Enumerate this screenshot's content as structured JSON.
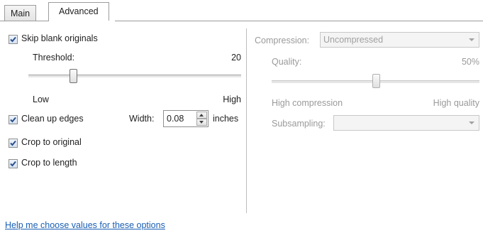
{
  "tabs": [
    {
      "label": "Main"
    },
    {
      "label": "Advanced"
    }
  ],
  "left": {
    "skip_blank": {
      "label": "Skip blank originals",
      "checked": true
    },
    "threshold": {
      "label": "Threshold:",
      "value": "20",
      "low": "Low",
      "high": "High",
      "level_fraction": 0.25
    },
    "clean_edges": {
      "label": "Clean up edges",
      "checked": true,
      "width_label": "Width:",
      "width_value": "0.08",
      "unit": "inches"
    },
    "crop_original": {
      "label": "Crop to original",
      "checked": true
    },
    "crop_length": {
      "label": "Crop to length",
      "checked": true
    }
  },
  "right": {
    "compression": {
      "label": "Compression:",
      "value": "Uncompressed"
    },
    "quality": {
      "label": "Quality:",
      "value": "50%",
      "low": "High compression",
      "high": "High quality",
      "level_fraction": 0.5
    },
    "subsampling": {
      "label": "Subsampling:",
      "value": ""
    }
  },
  "help_link": "Help me choose values for these options",
  "colors": {
    "accent": "#1a5fb4",
    "check": "#2b4f8c",
    "disabled_text": "#9a9a9a"
  }
}
